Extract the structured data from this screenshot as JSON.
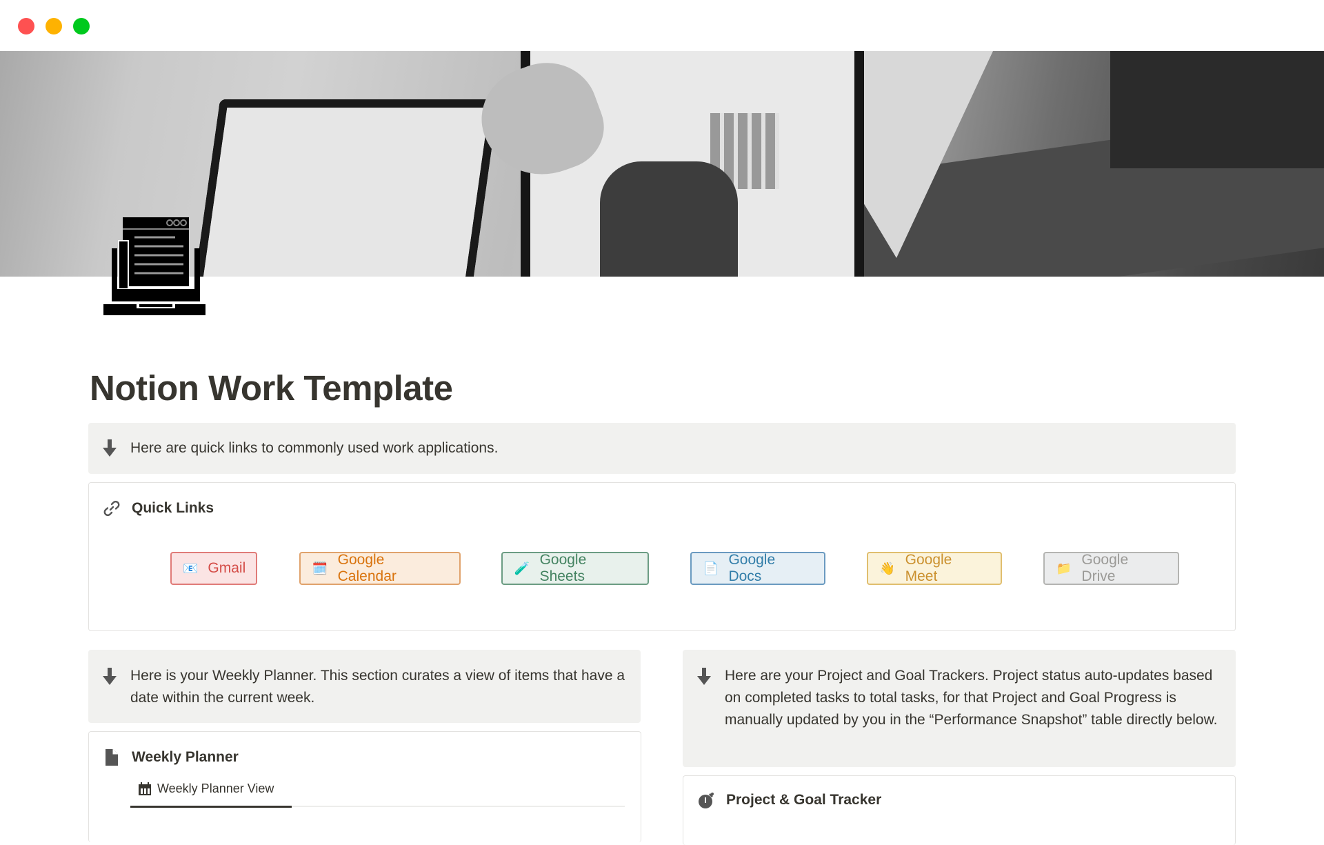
{
  "window": {
    "controls": [
      "close",
      "minimize",
      "maximize"
    ],
    "control_colors": {
      "close": "#fe5151",
      "minimize": "#feb201",
      "maximize": "#00c91d"
    }
  },
  "page": {
    "cover_description": "Grayscale photo of people working on laptops at a desk",
    "icon": "laptop-document-icon",
    "title": "Notion Work Template"
  },
  "callouts": {
    "quick_links_intro": "Here are quick links to commonly used work applications.",
    "weekly_planner_intro": "Here is your Weekly Planner. This section curates a view of items that have a date within the current week.",
    "project_tracker_intro": "Here are your Project and Goal Trackers. Project status auto-updates based on completed tasks to total tasks, for that Project and Goal Progress is manually updated by you in the “Performance Snapshot” table directly below."
  },
  "quick_links": {
    "title": "Quick Links",
    "icon": "link-icon",
    "buttons": [
      {
        "label": "Gmail",
        "emoji": "📧",
        "color": "#d44c47",
        "bg": "#fbe4e4",
        "border": "#e07b78"
      },
      {
        "label": "Google Calendar",
        "emoji": "🗓️",
        "color": "#d9730d",
        "bg": "#fbecdd",
        "border": "#e0a26b"
      },
      {
        "label": "Google Sheets",
        "emoji": "🧪",
        "color": "#448361",
        "bg": "#e8f1ec",
        "border": "#6b9c83"
      },
      {
        "label": "Google Docs",
        "emoji": "📄",
        "color": "#337ea9",
        "bg": "#e6eff5",
        "border": "#6a9ac0"
      },
      {
        "label": "Google Meet",
        "emoji": "👋",
        "color": "#cb912f",
        "bg": "#fbf3db",
        "border": "#e0be6e"
      },
      {
        "label": "Google Drive",
        "emoji": "📁",
        "color": "#9b9a97",
        "bg": "#ebeced",
        "border": "#b4b4b2"
      }
    ]
  },
  "weekly_planner": {
    "title": "Weekly Planner",
    "icon": "document-icon",
    "tabs": [
      {
        "label": "Weekly Planner View",
        "icon": "calendar-icon",
        "active": true
      }
    ]
  },
  "project_tracker": {
    "title": "Project & Goal Tracker",
    "icon": "stopwatch-icon"
  }
}
